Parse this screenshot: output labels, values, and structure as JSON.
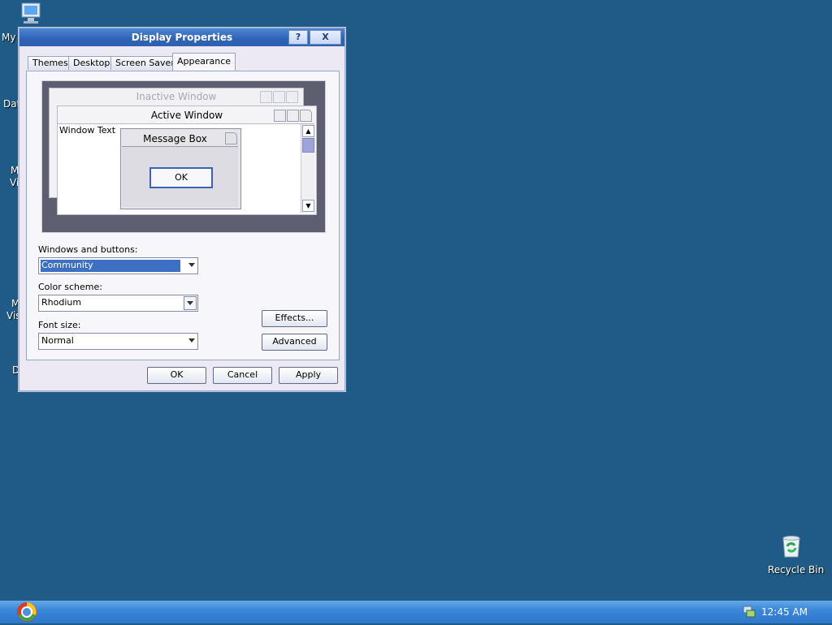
{
  "desktop": {
    "icons": [
      {
        "label": "My"
      },
      {
        "label": "Dat"
      },
      {
        "label": "M"
      },
      {
        "label": "Vi"
      },
      {
        "label": "M"
      },
      {
        "label": "Vis"
      },
      {
        "label": "D"
      }
    ],
    "recycle_bin": "Recycle Bin"
  },
  "dialog": {
    "title": "Display Properties",
    "help_btn": "?",
    "close_btn": "X",
    "tabs": [
      {
        "label": "Themes"
      },
      {
        "label": "Desktop"
      },
      {
        "label": "Screen Saver"
      },
      {
        "label": "Appearance"
      }
    ],
    "preview": {
      "inactive_window": "Inactive Window",
      "active_window": "Active Window",
      "window_text": "Window Text",
      "message_box": "Message Box",
      "ok": "OK"
    },
    "fields": {
      "windows_buttons_label": "Windows and buttons:",
      "windows_buttons_value": "Community",
      "color_scheme_label": "Color scheme:",
      "color_scheme_value": "Rhodium",
      "font_size_label": "Font size:",
      "font_size_value": "Normal"
    },
    "buttons": {
      "effects": "Effects...",
      "advanced": "Advanced",
      "ok": "OK",
      "cancel": "Cancel",
      "apply": "Apply"
    }
  },
  "taskbar": {
    "clock": "12:45 AM"
  },
  "colors": {
    "desktop": "#1f5b86",
    "titlebar": "#2f62b3",
    "selection": "#3d6fc3"
  }
}
